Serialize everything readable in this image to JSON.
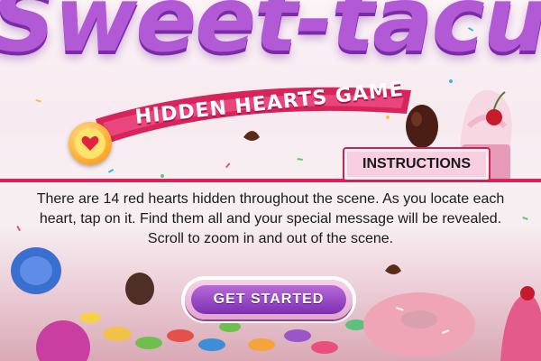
{
  "game": {
    "title": "Sweet-tacular",
    "subtitle": "HIDDEN HEARTS GAME"
  },
  "instructions": {
    "heading": "INSTRUCTIONS",
    "text": "There are 14 red hearts hidden throughout the scene. As you locate each heart, tap on it. Find them all and your special message will be revealed. Scroll to zoom in and out of the scene."
  },
  "cta": {
    "label": "GET STARTED"
  },
  "icons": {
    "badge": "heart-icon"
  },
  "colors": {
    "title_purple": "#b25ad6",
    "banner_pink": "#d8245a",
    "button_purple": "#8a3cc0",
    "heart_red": "#e0243f"
  }
}
